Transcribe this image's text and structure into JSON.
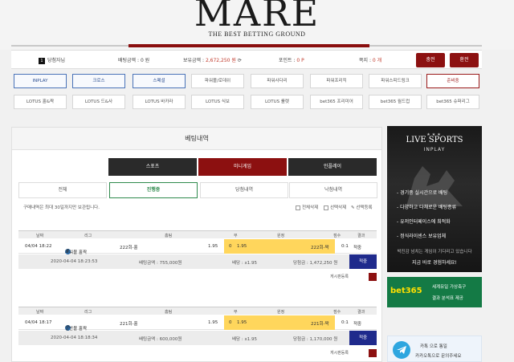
{
  "brand": {
    "logo": "MARE",
    "tagline": "THE BEST BETTING GROUND"
  },
  "info": {
    "level": "1",
    "user": "당첨자님",
    "bet_money_label": "배팅금액 :",
    "bet_money": "0 원",
    "balance_label": "보유금액 :",
    "balance": "2,672,250 원",
    "point_label": "포인트 :",
    "point": "0 P",
    "note_label": "쪽지 :",
    "note": "0 개",
    "deposit": "충전",
    "withdraw": "환전"
  },
  "nav_row1": [
    "INPLAY",
    "크로스",
    "스페셜",
    "파워볼/로데쉬",
    "파워사다리",
    "파워프리킥",
    "파워스피드링크",
    "준비중"
  ],
  "nav_row2": [
    "LOTUS 홀&짝",
    "LOTUS 드&사",
    "LOTUS 바카라",
    "LOTUS 식보",
    "LOTUS 룰렛",
    "bet365 프리미어",
    "bet365 월드컵",
    "bet365 슈퍼리그"
  ],
  "panel": {
    "title": "베팅내역",
    "tabs": [
      "스포츠",
      "미니게임",
      "인플레이"
    ],
    "subtabs": [
      "전체",
      "진행중",
      "당첨내역",
      "낙첨내역"
    ],
    "notice": "구매내역은 최대 30일까지만 보관됩니다.",
    "actions": [
      "전체삭제",
      "선택삭제",
      "선택등록"
    ]
  },
  "table_headers": [
    "날짜",
    "리그",
    "홈팀",
    "무",
    "원정",
    "점수",
    "결과"
  ],
  "bets": [
    {
      "date": "04/04 18:22",
      "league": "파워볼 홀짝",
      "home": "222회-홀",
      "home_odds": "1.95",
      "draw": "0",
      "away_odds": "1.95",
      "away": "222회-짝",
      "score": "0:1",
      "result": "적중",
      "bet_time": "2020-04-04 18:23:53",
      "bet_amount": "배팅금액 : 755,000원",
      "total_odds": "배당 : x1.95",
      "win_amount": "당첨금 : 1,472,250 원",
      "button": "적중",
      "tail": "게시판등록"
    },
    {
      "date": "04/04 18:17",
      "league": "일반볼 홀짝",
      "home": "221회-홀",
      "home_odds": "1.95",
      "draw": "0",
      "away_odds": "1.95",
      "away": "221회-짝",
      "score": "0:1",
      "result": "적중",
      "bet_time": "2020-04-04 18:18:34",
      "bet_amount": "배팅금액 : 600,000원",
      "total_odds": "배당 : x1.95",
      "win_amount": "당첨금 : 1,170,000 원",
      "button": "적중",
      "tail": "게시판등록"
    }
  ],
  "sidebar": {
    "live_title": "LIVE SPORTS",
    "live_sub": "INPLAY",
    "features": [
      "경기중 실시간으로 배팅",
      "다양하고 다채로운 배팅종류",
      "유저인터페이스에 최적화",
      "정식라이센스 보유업체"
    ],
    "foot1": "박진감 넘치는 게임이 기다리고 있습니다",
    "foot2": "지금 바로 경험하세요!",
    "bet365_logo": "bet365",
    "bet365_t1": "세계유일 가상축구",
    "bet365_t2": "결과 분석표 제공",
    "tg_t1": "카톡 으로 통일",
    "tg_t2": "카카오톡으로 문의주세요"
  },
  "colors": {
    "brand_red": "#8c1010",
    "pick_yellow": "#ffd65c",
    "nav_blue": "#4a73b8",
    "bet365_green": "#147a45"
  }
}
